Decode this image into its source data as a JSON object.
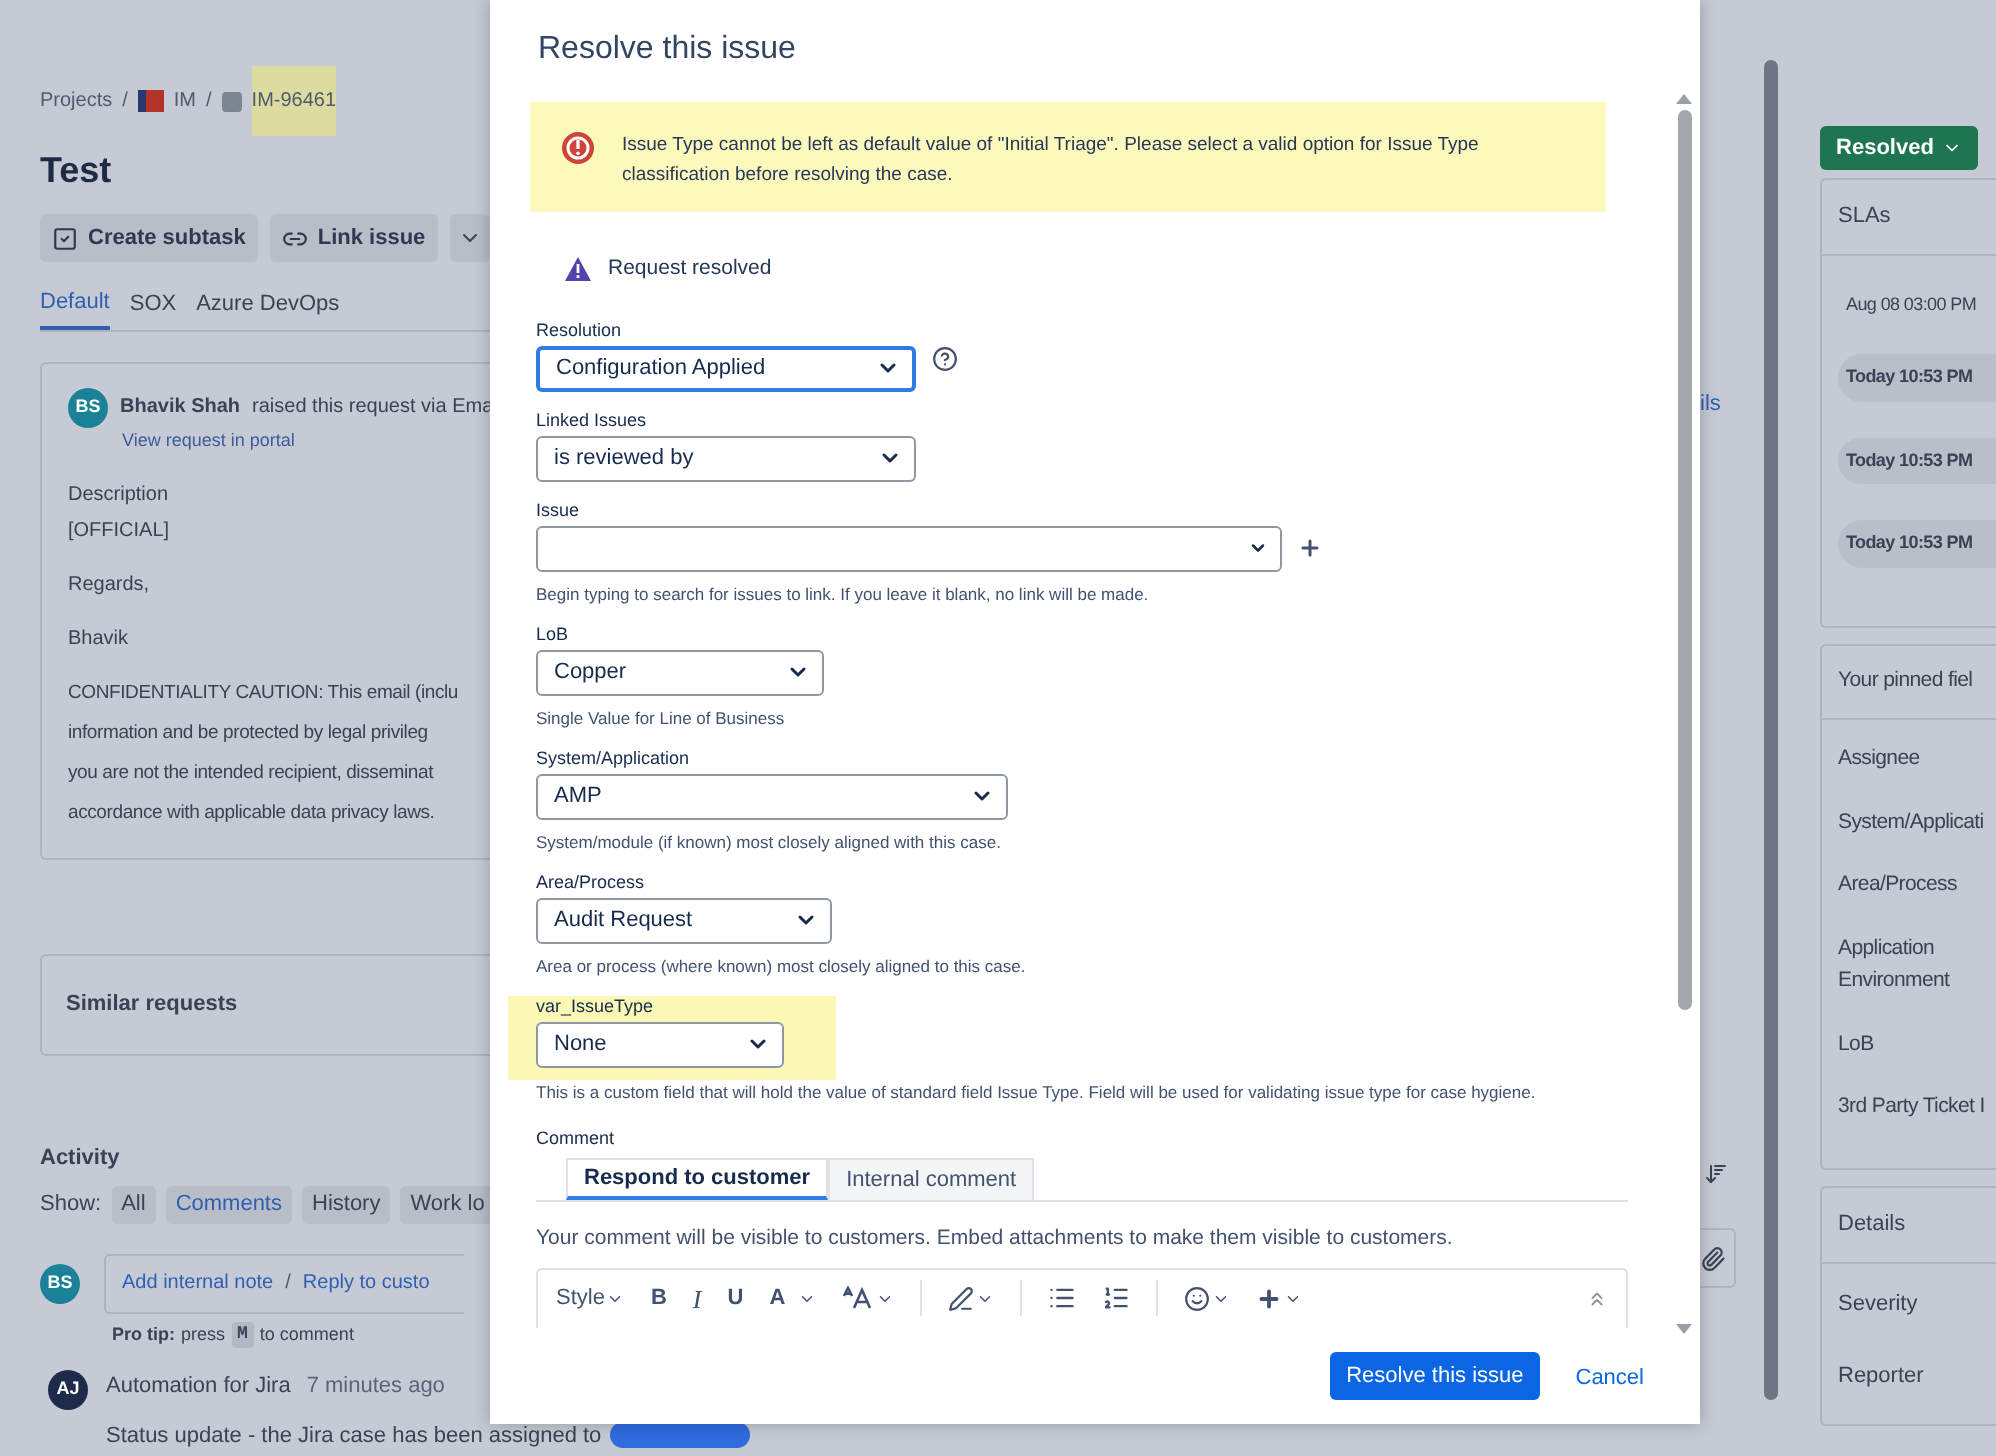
{
  "breadcrumb": {
    "items": [
      {
        "label": "Projects",
        "kind": "text",
        "highlighted": false
      },
      {
        "label": "IM",
        "kind": "project",
        "highlighted": false
      },
      {
        "label": "IM-96461",
        "kind": "issue",
        "highlighted": true
      }
    ],
    "separators": [
      "/",
      "/"
    ]
  },
  "issue_title": "Test",
  "actions": [
    {
      "label": "Create subtask",
      "kind": "subtask"
    },
    {
      "label": "Link issue",
      "kind": "link"
    },
    {
      "kind": "menu"
    }
  ],
  "view_tabs": [
    {
      "label": "Default",
      "selected": true
    },
    {
      "label": "SOX",
      "selected": false
    },
    {
      "label": "Azure DevOps",
      "selected": false
    }
  ],
  "request_card": {
    "avatar": "BS",
    "reporter": "Bhavik Shah",
    "raised_text": "raised this request via Ema",
    "portal_link": "View request in portal",
    "lines": [
      "Description",
      "[OFFICIAL]",
      "Regards,",
      "Bhavik"
    ],
    "caution": [
      "CONFIDENTIALITY CAUTION: This email (inclu",
      "information and be protected by legal privileg",
      "you are not the intended recipient, disseminat",
      "accordance with applicable data privacy laws."
    ]
  },
  "side_link": "ils",
  "similar_requests": "Similar requests",
  "activity": {
    "title": "Activity",
    "show_label": "Show:",
    "filters": [
      {
        "label": "All",
        "selected": false
      },
      {
        "label": "Comments",
        "selected": true
      },
      {
        "label": "History",
        "selected": false
      },
      {
        "label": "Work lo",
        "selected": false
      }
    ],
    "composer": {
      "avatar": "BS",
      "add_note": "Add internal note",
      "separator": "/",
      "reply": "Reply to custo"
    },
    "pro_tip": {
      "label": "Pro tip:",
      "before": "press",
      "key": "M",
      "after": "to comment"
    },
    "entries": [
      {
        "avatar": "AJ",
        "author": "Automation for Jira",
        "time": "7 minutes ago",
        "text": "Status update - the Jira case has been assigned to"
      }
    ]
  },
  "status_button": "Resolved",
  "slas": {
    "title": "SLAs",
    "times": [
      {
        "label": "Aug 08 03:00 PM",
        "kind": "plain"
      },
      {
        "label": "Today 10:53 PM",
        "kind": "pill"
      },
      {
        "label": "Today 10:53 PM",
        "kind": "pill"
      },
      {
        "label": "Today 10:53 PM",
        "kind": "pill"
      }
    ]
  },
  "pinned": {
    "title": "Your pinned fiel",
    "fields": [
      "Assignee",
      "System/Applicati",
      "Area/Process",
      "Application Environment",
      "LoB",
      "3rd Party Ticket I"
    ]
  },
  "details": {
    "title": "Details",
    "fields": [
      "Severity",
      "Reporter"
    ]
  },
  "dialog": {
    "title": "Resolve this issue",
    "error": "Issue Type cannot be left as default value of \"Initial Triage\". Please select a valid option for Issue Type classification before resolving the case.",
    "notice": "Request resolved",
    "fields": [
      {
        "label": "Resolution",
        "kind": "select",
        "value": "Configuration Applied",
        "focused": true,
        "help": true,
        "highlighted": false
      },
      {
        "label": "Linked Issues",
        "kind": "select",
        "value": "is reviewed by",
        "focused": false,
        "help": false,
        "highlighted": false
      },
      {
        "label": "Issue",
        "kind": "combo",
        "focused": false,
        "help": false,
        "add": true,
        "highlighted": false,
        "hint": "Begin typing to search for issues to link. If you leave it blank, no link will be made."
      },
      {
        "label": "LoB",
        "kind": "select",
        "value": "Copper",
        "focused": false,
        "help": false,
        "highlighted": false,
        "hint": "Single Value for Line of Business"
      },
      {
        "label": "System/Application",
        "kind": "select",
        "value": "AMP",
        "focused": false,
        "help": false,
        "highlighted": false,
        "hint": "System/module (if known) most closely aligned with this case."
      },
      {
        "label": "Area/Process",
        "kind": "select",
        "value": "Audit Request",
        "focused": false,
        "help": false,
        "highlighted": false,
        "hint": "Area or process (where known) most closely aligned to this case."
      },
      {
        "label": "var_IssueType",
        "kind": "select",
        "value": "None",
        "focused": false,
        "help": false,
        "highlighted": true,
        "hint": "This is a custom field that will hold the value of standard field Issue Type. Field will be used for validating issue type for case hygiene."
      }
    ],
    "comment_label": "Comment",
    "comment_tabs": [
      {
        "label": "Respond to customer",
        "selected": true
      },
      {
        "label": "Internal comment",
        "selected": false
      }
    ],
    "comment_note": "Your comment will be visible to customers. Embed attachments to make them visible to customers.",
    "toolbar": [
      {
        "kind": "style",
        "label": "Style"
      },
      {
        "kind": "bold",
        "label": "B"
      },
      {
        "kind": "italic",
        "label": "I"
      },
      {
        "kind": "underline",
        "label": "U"
      },
      {
        "kind": "color",
        "label": "A"
      },
      {
        "kind": "size"
      },
      {
        "kind": "link"
      },
      {
        "kind": "bullets"
      },
      {
        "kind": "numbers"
      },
      {
        "kind": "emoji"
      },
      {
        "kind": "insert"
      },
      {
        "kind": "collapse"
      }
    ],
    "primary_button": "Resolve this issue",
    "cancel": "Cancel"
  }
}
